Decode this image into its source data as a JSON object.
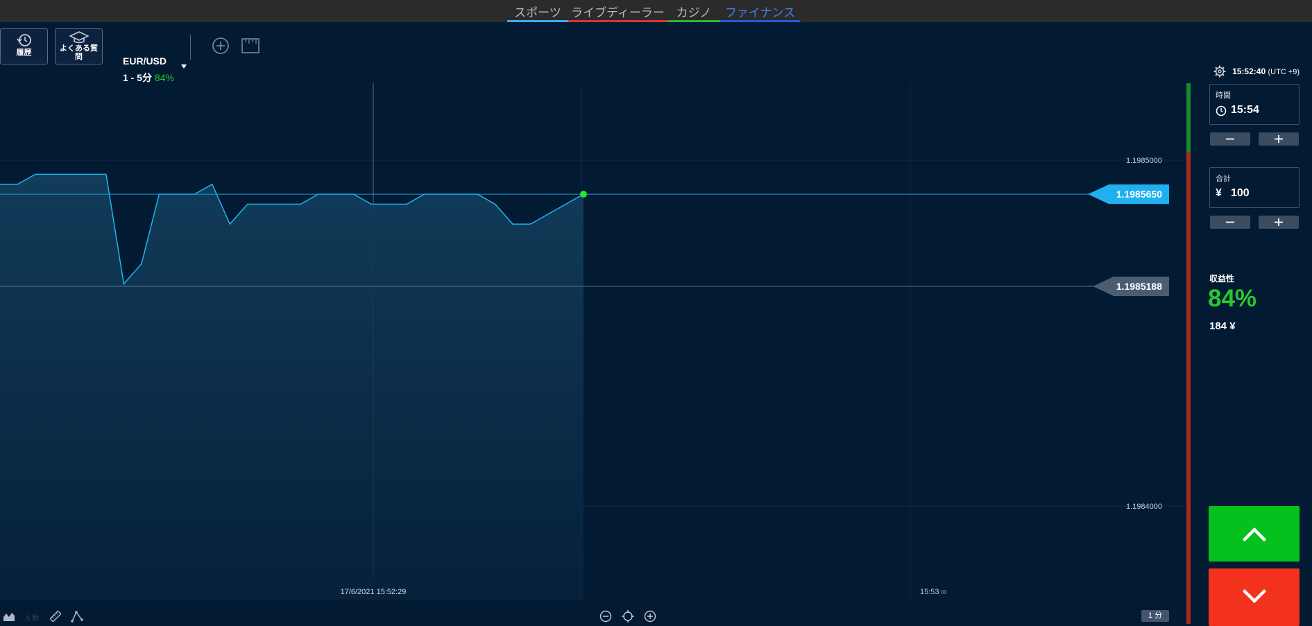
{
  "nav": {
    "tabs": [
      {
        "label": "スポーツ",
        "color": "#3fa9f5"
      },
      {
        "label": "ライブディーラー",
        "color": "#e0322f"
      },
      {
        "label": "カジノ",
        "color": "#2fb531"
      },
      {
        "label": "ファイナンス",
        "color": "#2f56d8",
        "active": true
      }
    ]
  },
  "toolbar": {
    "history_label": "履歴",
    "faq_label": "よくある質問",
    "asset": "EUR/USD",
    "terms": "1 - 5分",
    "payout": "84%",
    "icons": [
      "history-icon",
      "graduation-cap-icon",
      "dropdown-caret-icon",
      "add-circle-icon",
      "ruler-icon"
    ]
  },
  "clock": {
    "time": "15:52:40",
    "tz": "(UTC +9)",
    "icon": "gear-icon"
  },
  "sidebar": {
    "time_caption": "時間",
    "time_value": "15:54",
    "amount_caption": "合計",
    "amount_currency": "¥",
    "amount_value": "100",
    "profit_caption": "収益性",
    "profit_pct": "84%",
    "profit_amount": "184 ¥",
    "up_color": "#06c01d",
    "down_color": "#f2321d"
  },
  "chart": {
    "current_price": "1.1985650",
    "open_price": "1.1985188",
    "y_ticks": [
      "1.1985000",
      "1.1984000"
    ],
    "time_label": "17/6/2021 15:52:29",
    "time_tick_main": "15:53",
    "time_tick_sub": ":00",
    "line_color": "#1fb6f0",
    "point_color": "#27e432",
    "chart_data": {
      "type": "area",
      "ylim": [
        1.19838,
        1.19862
      ],
      "series": [
        {
          "values": [
            1.19857,
            1.19857,
            1.198575,
            1.198575,
            1.198575,
            1.198575,
            1.198575,
            1.19852,
            1.19853,
            1.198565,
            1.198565,
            1.198565,
            1.19857,
            1.19855,
            1.19856,
            1.19856,
            1.19856,
            1.19856,
            1.198565,
            1.198565,
            1.198565,
            1.19856,
            1.19856,
            1.19856,
            1.198565,
            1.198565,
            1.198565,
            1.198565,
            1.19856,
            1.19855,
            1.19855,
            1.198555,
            1.19856,
            1.198565
          ]
        }
      ]
    }
  },
  "bottombar": {
    "speed_label": "5 秒",
    "interval_label": "1 分",
    "icons": [
      "area-chart-icon",
      "ruler-icon",
      "draw-tool-icon",
      "zoom-out-icon",
      "center-icon",
      "zoom-in-icon"
    ]
  }
}
